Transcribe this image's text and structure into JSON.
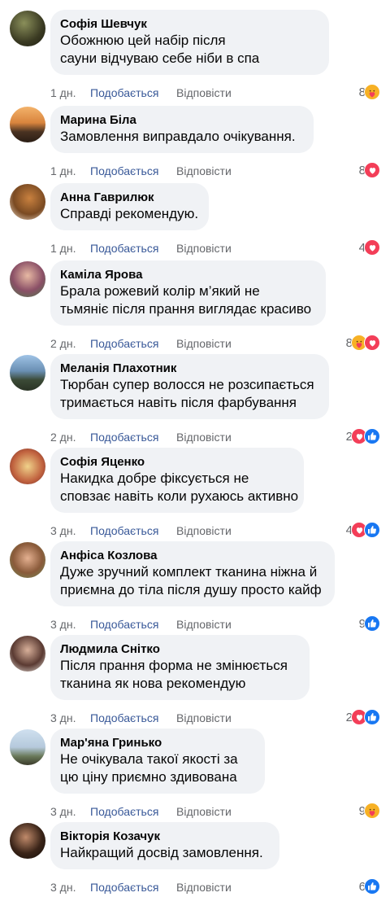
{
  "labels": {
    "like": "Подобається",
    "reply": "Відповісти"
  },
  "colors": {
    "like_blue": "#1877f2",
    "love_red": "#f33e58",
    "care_yellow": "#f7b125",
    "link_blue": "#385898",
    "meta_gray": "#65676b",
    "bubble_bg": "#f0f2f5"
  },
  "comments": [
    {
      "author": "Софія Шевчук",
      "lines": [
        "Обожнюю цей набір після",
        "сауни відчуваю себе ніби в спа"
      ],
      "time": "1 дн.",
      "count": "8",
      "reactions": [
        "care"
      ]
    },
    {
      "author": "Марина Біла",
      "lines": [
        "Замовлення виправдало очікування."
      ],
      "time": "1 дн.",
      "count": "8",
      "reactions": [
        "love"
      ]
    },
    {
      "author": "Анна Гаврилюк",
      "lines": [
        "Справді рекомендую."
      ],
      "time": "1 дн.",
      "count": "4",
      "reactions": [
        "love"
      ]
    },
    {
      "author": "Каміла Ярова",
      "lines": [
        "Брала рожевий колір м’який не",
        "тьмяніє після прання виглядає красиво"
      ],
      "time": "2 дн.",
      "count": "8",
      "reactions": [
        "care",
        "love"
      ]
    },
    {
      "author": "Меланія Плахотник",
      "lines": [
        "Тюрбан супер волосся не розсипається",
        "тримається навіть після фарбування"
      ],
      "time": "2 дн.",
      "count": "2",
      "reactions": [
        "love",
        "like"
      ]
    },
    {
      "author": "Софія Яценко",
      "lines": [
        "Накидка добре фіксується не",
        "сповзає навіть коли рухаюсь активно"
      ],
      "time": "3 дн.",
      "count": "4",
      "reactions": [
        "love",
        "like"
      ]
    },
    {
      "author": "Анфіса Козлова",
      "lines": [
        "Дуже зручний комплект тканина ніжна й",
        "приємна до тіла після душу просто кайф"
      ],
      "time": "3 дн.",
      "count": "9",
      "reactions": [
        "like"
      ]
    },
    {
      "author": "Людмила Снітко",
      "lines": [
        "Після прання форма не змінюється",
        "тканина як нова рекомендую"
      ],
      "time": "3 дн.",
      "count": "2",
      "reactions": [
        "love",
        "like"
      ]
    },
    {
      "author": "Мар'яна Гринько",
      "lines": [
        "Не очікувала такої якості за",
        "цю ціну приємно здивована"
      ],
      "time": "3 дн.",
      "count": "9",
      "reactions": [
        "care"
      ]
    },
    {
      "author": "Вікторія Козачук",
      "lines": [
        "Найкращий досвід замовлення."
      ],
      "time": "3 дн.",
      "count": "6",
      "reactions": [
        "like"
      ]
    }
  ]
}
